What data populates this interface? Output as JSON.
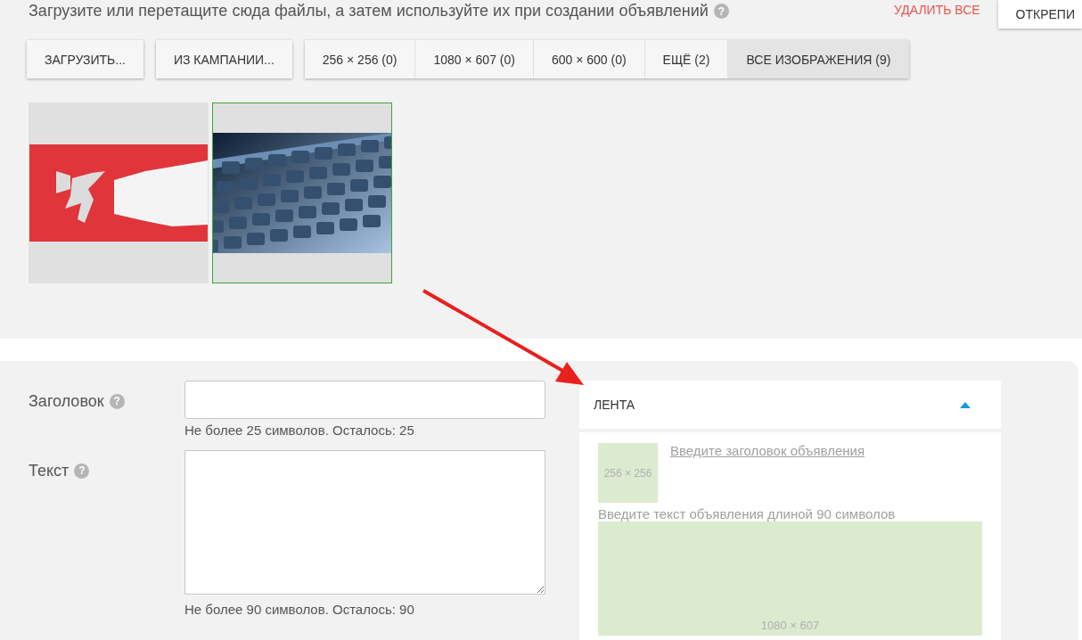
{
  "instruction": "Загрузите или перетащите сюда файлы, а затем используйте их при создании объявлений",
  "delete_all": "УДАЛИТЬ ВСЕ",
  "pin_button": "ОТКРЕПИ",
  "upload_buttons": [
    "ЗАГРУЗИТЬ...",
    "ИЗ КАМПАНИИ..."
  ],
  "filters": [
    {
      "label": "256 × 256 (0)",
      "selected": false
    },
    {
      "label": "1080 × 607 (0)",
      "selected": false
    },
    {
      "label": "600 × 600 (0)",
      "selected": false
    },
    {
      "label": "ЕЩЁ (2)",
      "selected": false
    },
    {
      "label": "ВСЕ ИЗОБРАЖЕНИЯ (9)",
      "selected": true
    }
  ],
  "instruction_help": "?",
  "images": [
    {
      "kind": "picture",
      "selected": false
    },
    {
      "kind": "picture",
      "selected": true
    }
  ],
  "form": [
    {
      "label": "Заголовок",
      "help": "?",
      "kind": "input",
      "hint": "Не более 25 символов. Осталось: 25"
    },
    {
      "label": "Текст",
      "help": "?",
      "kind": "textarea",
      "hint": "Не более 90 символов. Осталось: 90"
    }
  ],
  "preview": {
    "title": "ЛЕНТА",
    "expanded": true,
    "icon_size": "256 × 256",
    "headline": "Введите заголовок объявления",
    "body": "Введите текст объявления длиной 90 символов",
    "image_size": "1080 × 607"
  }
}
